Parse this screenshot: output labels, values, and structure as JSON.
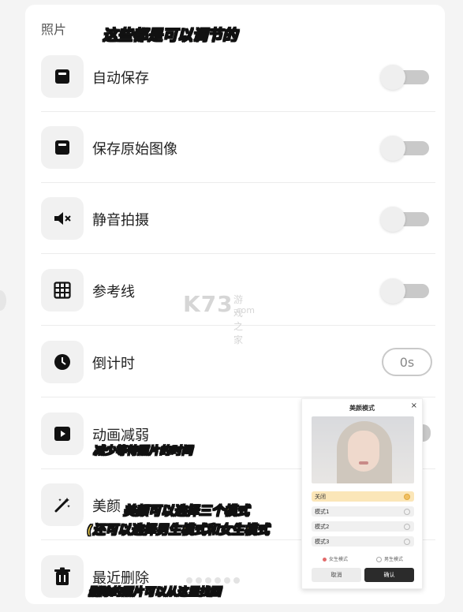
{
  "section": {
    "title": "照片"
  },
  "rows": [
    {
      "label": "自动保存",
      "icon": "save-icon",
      "control": "toggle"
    },
    {
      "label": "保存原始图像",
      "icon": "save-original-icon",
      "control": "toggle"
    },
    {
      "label": "静音拍摄",
      "icon": "mute-speaker-icon",
      "control": "toggle"
    },
    {
      "label": "参考线",
      "icon": "grid-icon",
      "control": "toggle"
    },
    {
      "label": "倒计时",
      "icon": "clock-icon",
      "control": "timer",
      "value": "0s"
    },
    {
      "label": "动画减弱",
      "icon": "play-icon",
      "control": "toggle"
    },
    {
      "label": "美颜",
      "icon": "magic-wand-icon",
      "control": "none"
    },
    {
      "label": "最近删除",
      "icon": "trash-icon",
      "control": "none"
    }
  ],
  "annotations": {
    "top": "这些都是可以调节的",
    "animation": "减少等待照片的时间",
    "beauty_line1": "美颜可以选择三个模式",
    "beauty_line2": "(还可以选择男生模式和女生模式",
    "deleted": "删除的照片可以从这里找回"
  },
  "watermark": {
    "logo": "K73",
    "site": "游戏之家",
    "domain": ".com"
  },
  "dialog": {
    "title": "美颜模式",
    "close": "×",
    "options": [
      "关闭",
      "模式1",
      "模式2",
      "模式3"
    ],
    "selected_index": 0,
    "gender_options": [
      "女生模式",
      "男生模式"
    ],
    "cancel_label": "取消",
    "confirm_label": "确认"
  },
  "colors": {
    "toggle_track": "#c9c9c9",
    "annotation_text": "#f4d44f",
    "selected_option": "#fbe6b8"
  }
}
